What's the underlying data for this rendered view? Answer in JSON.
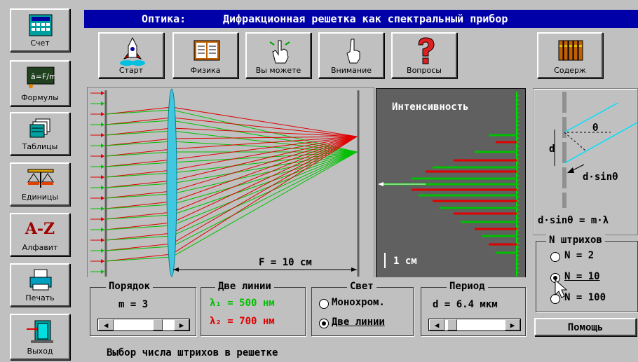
{
  "title": {
    "prefix": "Оптика:",
    "text": "Дифракционная решетка как спектральный прибор"
  },
  "sidebar": [
    {
      "name": "calc",
      "label": "Счет"
    },
    {
      "name": "formulas",
      "label": "Формулы"
    },
    {
      "name": "tables",
      "label": "Таблицы"
    },
    {
      "name": "units",
      "label": "Единицы"
    },
    {
      "name": "alphabet",
      "label": "Алфавит"
    },
    {
      "name": "print",
      "label": "Печать"
    },
    {
      "name": "exit",
      "label": "Выход"
    }
  ],
  "formula_icon_text": "ā=F/m",
  "alphabet_icon_text": "A-Z",
  "toolbar": [
    {
      "name": "start",
      "label": "Старт"
    },
    {
      "name": "physics",
      "label": "Физика"
    },
    {
      "name": "you-can",
      "label": "Вы можете"
    },
    {
      "name": "attention",
      "label": "Внимание"
    },
    {
      "name": "questions",
      "label": "Вопросы"
    },
    {
      "name": "contents",
      "label": "Содерж"
    }
  ],
  "lens_panel": {
    "focal_label": "F = 10 см"
  },
  "intensity_panel": {
    "title": "Интенсивность",
    "scale_label": "1 см"
  },
  "grating_diagram": {
    "theta": "θ",
    "d": "d",
    "path_diff": "d·sinθ",
    "formula": "d·sinθ = m·λ"
  },
  "order_group": {
    "title": "Порядок",
    "value": "m = 3",
    "slider_fraction": 0.78
  },
  "lines_group": {
    "title": "Две линии",
    "line1": "λ₁ = 500 нм",
    "line2": "λ₂ = 700 нм",
    "color1": "#00c000",
    "color2": "#e00000"
  },
  "light_group": {
    "title": "Свет",
    "options": [
      "Монохром.",
      "Две линии"
    ],
    "selected": 1
  },
  "period_group": {
    "title": "Период",
    "value": "d = 6.4 мкм",
    "slider_fraction": 0.05
  },
  "n_group": {
    "title": "N штрихов",
    "options": [
      "N = 2",
      "N = 10",
      "N = 100"
    ],
    "selected": 1
  },
  "help_button": "Помощь",
  "status_text": "Выбор числа штрихов в решетке"
}
